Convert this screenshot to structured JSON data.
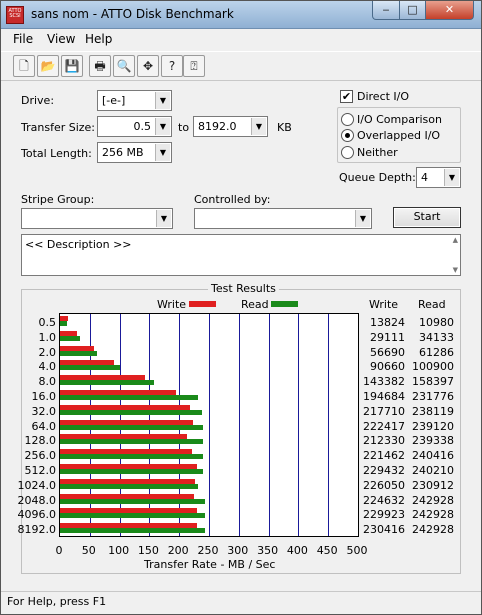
{
  "window": {
    "title": "sans nom - ATTO Disk Benchmark",
    "icon_text": "ATTO SCSI"
  },
  "title_buttons": {
    "minimize": "‒",
    "maximize": "□",
    "close": "✕"
  },
  "menu": [
    "File",
    "View",
    "Help"
  ],
  "toolbar": [
    {
      "name": "new-icon",
      "glyph": "🗋"
    },
    {
      "name": "open-icon",
      "glyph": "📂"
    },
    {
      "name": "save-icon",
      "glyph": "💾"
    },
    {
      "name": "print-icon",
      "glyph": "🖶"
    },
    {
      "name": "print-preview-icon",
      "glyph": "🔍"
    },
    {
      "name": "move-icon",
      "glyph": "✥"
    },
    {
      "name": "help-icon",
      "glyph": "?"
    },
    {
      "name": "context-help-icon",
      "glyph": "⍰"
    }
  ],
  "settings": {
    "drive_label": "Drive:",
    "drive_value": "[-e-]",
    "transfer_label": "Transfer Size:",
    "transfer_from": "0.5",
    "to_label": "to",
    "transfer_to": "8192.0",
    "kb_label": "KB",
    "length_label": "Total Length:",
    "length_value": "256 MB",
    "direct_io": "Direct I/O",
    "direct_io_checked": "✔",
    "io_comparison": "I/O Comparison",
    "overlapped_io": "Overlapped I/O",
    "neither": "Neither",
    "queue_label": "Queue Depth:",
    "queue_value": "4",
    "stripe_label": "Stripe Group:",
    "controlled_label": "Controlled by:",
    "start": "Start",
    "description": "<< Description >>"
  },
  "results": {
    "title": "Test Results",
    "write_label": "Write",
    "read_label": "Read",
    "col_write": "Write",
    "col_read": "Read",
    "write_color": "#e02020",
    "read_color": "#1a8a1a",
    "grid_color": "#1a1a9a",
    "xaxis_label": "Transfer Rate - MB / Sec"
  },
  "chart_data": {
    "type": "bar",
    "orientation": "horizontal",
    "title": "Test Results",
    "xlabel": "Transfer Rate - MB / Sec",
    "xlim": [
      0,
      500
    ],
    "xticks": [
      0,
      50,
      100,
      150,
      200,
      250,
      300,
      350,
      400,
      450,
      500
    ],
    "categories": [
      "0.5",
      "1.0",
      "2.0",
      "4.0",
      "8.0",
      "16.0",
      "32.0",
      "64.0",
      "128.0",
      "256.0",
      "512.0",
      "1024.0",
      "2048.0",
      "4096.0",
      "8192.0"
    ],
    "series": [
      {
        "name": "Write",
        "values": [
          13824,
          29111,
          56690,
          90660,
          143382,
          194684,
          217710,
          222417,
          212330,
          221462,
          229432,
          226050,
          224632,
          229923,
          230416
        ]
      },
      {
        "name": "Read",
        "values": [
          10980,
          34133,
          61286,
          100900,
          158397,
          231776,
          238119,
          239120,
          239338,
          240416,
          240210,
          230912,
          242928,
          242928,
          242928
        ]
      }
    ],
    "grid": true,
    "legend": "top"
  },
  "status": {
    "text": "For Help, press F1"
  }
}
